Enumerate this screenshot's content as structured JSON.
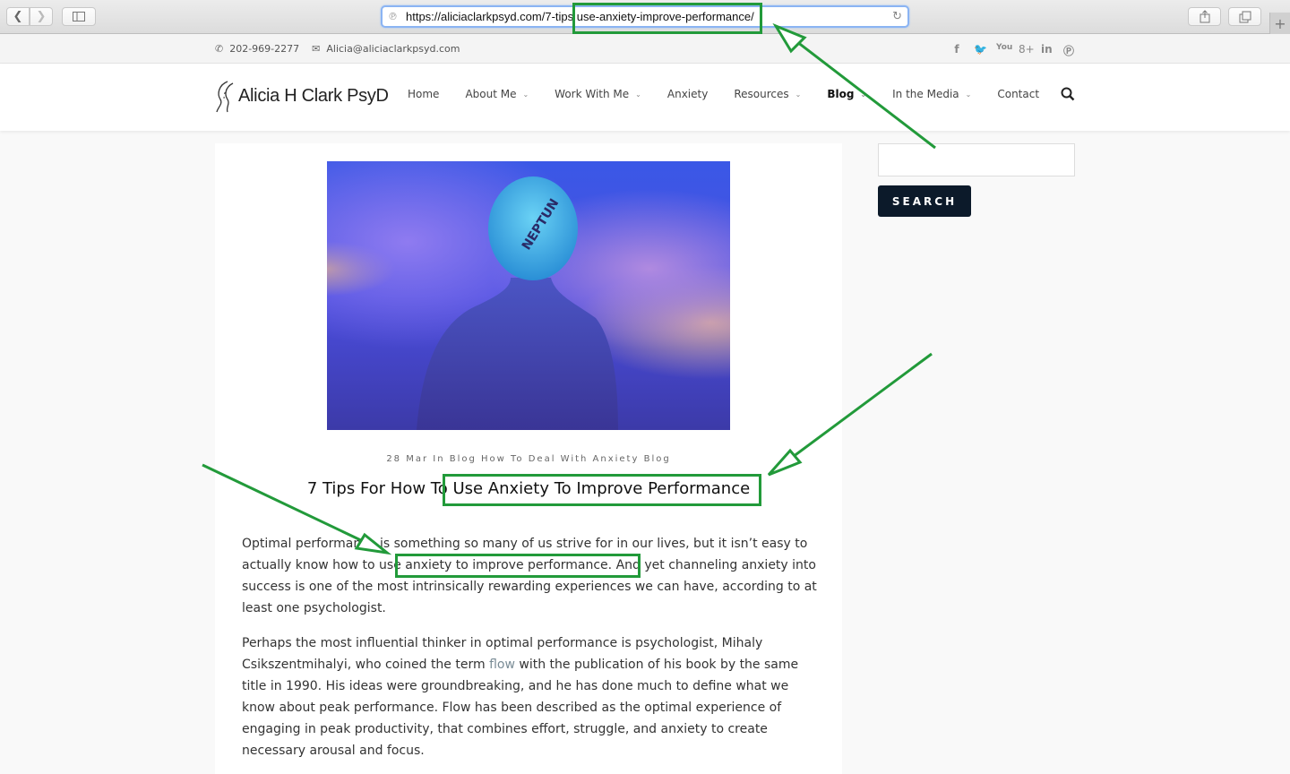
{
  "browser": {
    "url": "https://aliciaclarkpsyd.com/7-tips-use-anxiety-improve-performance/",
    "url_display": "https://aliciaclarkpsyd.com/7-tips use-anxiety-improve-performance/",
    "icons": {
      "back": "chevron-left-icon",
      "forward": "chevron-right-icon",
      "sidebar": "sidebar-icon",
      "share": "share-icon",
      "tabs": "tabs-icon",
      "new_tab": "plus-icon",
      "reload": "reload-icon"
    }
  },
  "topbar": {
    "phone": "202-969-2277",
    "email": "Alicia@aliciaclarkpsyd.com",
    "social": [
      "f",
      "t",
      "yt",
      "g+",
      "in",
      "p"
    ]
  },
  "header": {
    "logo_text": "Alicia H Clark PsyD",
    "menu": [
      {
        "label": "Home",
        "dropdown": false
      },
      {
        "label": "About Me",
        "dropdown": true
      },
      {
        "label": "Work With Me",
        "dropdown": true
      },
      {
        "label": "Anxiety",
        "dropdown": false
      },
      {
        "label": "Resources",
        "dropdown": true
      },
      {
        "label": "Blog",
        "dropdown": true,
        "active": true
      },
      {
        "label": "In the Media",
        "dropdown": true
      },
      {
        "label": "Contact",
        "dropdown": false
      }
    ],
    "chevron": "⌄"
  },
  "article": {
    "image_alt": "Swimmer in NEPTUN cap under blue lights",
    "meta": "28 Mar In Blog How To Deal With Anxiety Blog",
    "title": "7 Tips For How To Use Anxiety To Improve Performance",
    "p1": {
      "before": "Optimal performance is something so many of us strive for in our lives, but it isn’t easy to actually know how to ",
      "highlight": "use anxiety to improve performance",
      "after": ". And yet channeling anxiety into success is one of the most intrinsically rewarding experiences we can have, according to at least one psychologist."
    },
    "p2": {
      "before": "Perhaps the most influential thinker in optimal performance is psychologist, Mihaly Csikszentmihalyi, who coined the term ",
      "link": "flow",
      "after": " with the publication of his book by the same title in 1990. His ideas were groundbreaking, and he has done much to define what we know about peak performance. Flow has been described as the optimal experience of engaging in peak productivity, that combines effort, struggle, and anxiety to create necessary arousal and focus."
    }
  },
  "sidebar": {
    "search_value": "",
    "search_button": "SEARCH"
  },
  "annotations": {
    "color": "#229a3a"
  }
}
